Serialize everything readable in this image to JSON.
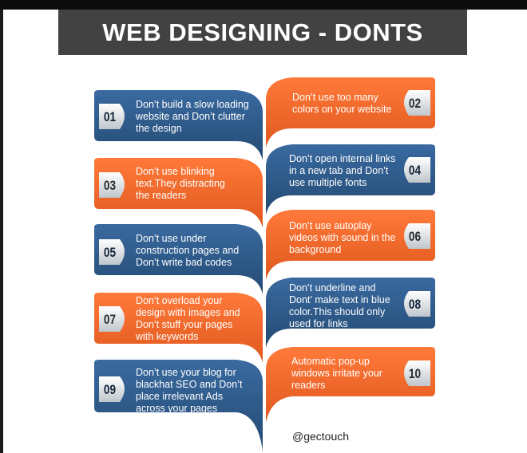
{
  "banner": {
    "title": "WEB DESIGNING - DONTS"
  },
  "colors": {
    "blue": "#2f5b8a",
    "orange": "#f26a2e",
    "banner": "#424242"
  },
  "items": [
    {
      "num": "01",
      "text": "Don’t build a slow loading\nwebsite and Don’t clutter\nthe design"
    },
    {
      "num": "02",
      "text": "Don’t use too many\ncolors on your website"
    },
    {
      "num": "03",
      "text": "Don’t use blinking\ntext.They distracting\nthe readers"
    },
    {
      "num": "04",
      "text": "Don’t open internal links\nin a new tab and Don’t\nuse multiple fonts"
    },
    {
      "num": "05",
      "text": "Don’t use under\nconstruction pages and\nDon’t write bad codes"
    },
    {
      "num": "06",
      "text": "Don’t use autoplay\nvideos with sound in the\nbackground"
    },
    {
      "num": "07",
      "text": "Don’t overload  your\ndesign with images and\nDon’t stuff your pages\nwith keywords"
    },
    {
      "num": "08",
      "text": "Don’t underline and\nDont’ make text in blue\ncolor.This should only\nused for links"
    },
    {
      "num": "09",
      "text": "Don’t use your blog for\nblackhat SEO and Don’t\nplace irrelevant Ads\nacross your pages"
    },
    {
      "num": "10",
      "text": "Automatic pop-up\nwindows irritate your\nreaders"
    }
  ],
  "credit": "@gectouch"
}
